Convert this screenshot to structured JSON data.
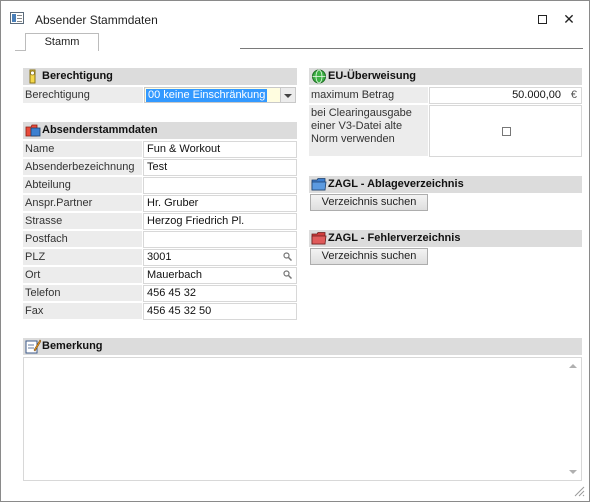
{
  "window": {
    "title": "Absender Stammdaten",
    "maximize_icon": "maximize-icon",
    "close_label": "✕"
  },
  "tabs": [
    {
      "label": "Stamm"
    }
  ],
  "berechtigung": {
    "header": "Berechtigung",
    "label": "Berechtigung",
    "value": "00 keine Einschränkung"
  },
  "absender": {
    "header": "Absenderstammdaten",
    "fields": [
      {
        "label": "Name",
        "value": "Fun & Workout"
      },
      {
        "label": "Absenderbezeichnung",
        "value": "Test"
      },
      {
        "label": "Abteilung",
        "value": ""
      },
      {
        "label": "Anspr.Partner",
        "value": "Hr. Gruber"
      },
      {
        "label": "Strasse",
        "value": "Herzog Friedrich Pl."
      },
      {
        "label": "Postfach",
        "value": ""
      },
      {
        "label": "PLZ",
        "value": "3001"
      },
      {
        "label": "Ort",
        "value": "Mauerbach"
      },
      {
        "label": "Telefon",
        "value": "456 45 32"
      },
      {
        "label": "Fax",
        "value": "456 45 32 50"
      }
    ]
  },
  "eu": {
    "header": "EU-Überweisung",
    "max_label": "maximum Betrag",
    "max_value": "50.000,00",
    "currency": "€",
    "clearing_label": "bei Clearingausgabe einer V3-Datei alte Norm verwenden",
    "clearing_checked": false
  },
  "zagl_ablage": {
    "header": "ZAGL - Ablageverzeichnis",
    "button": "Verzeichnis suchen"
  },
  "zagl_fehler": {
    "header": "ZAGL - Fehlerverzeichnis",
    "button": "Verzeichnis suchen"
  },
  "bemerkung": {
    "header": "Bemerkung",
    "value": ""
  },
  "colors": {
    "group_header_bg": "#dcdcdc",
    "label_bg": "#ececec",
    "selection": "#3399ff",
    "combo_bg": "#fffde0"
  }
}
